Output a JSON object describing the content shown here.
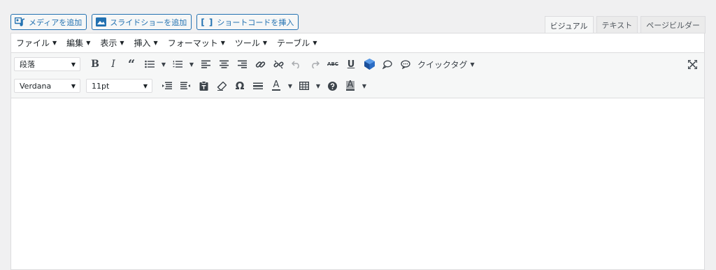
{
  "media_buttons": {
    "add_media": "メディアを追加",
    "add_slideshow": "スライドショーを追加",
    "insert_shortcode": "ショートコードを挿入"
  },
  "tabs": {
    "visual": "ビジュアル",
    "text": "テキスト",
    "page_builder": "ページビルダー"
  },
  "menubar": {
    "file": "ファイル",
    "edit": "編集",
    "view": "表示",
    "insert": "挿入",
    "format": "フォーマット",
    "tools": "ツール",
    "table": "テーブル"
  },
  "toolbar": {
    "block_format": "段落",
    "quicktags": "クイックタグ",
    "font_family": "Verdana",
    "font_size": "11pt"
  },
  "colors": {
    "accent": "#2271b1",
    "background": "#f0f0f1",
    "toolbar_bg": "#f6f7f7",
    "border": "#dcdcde"
  }
}
